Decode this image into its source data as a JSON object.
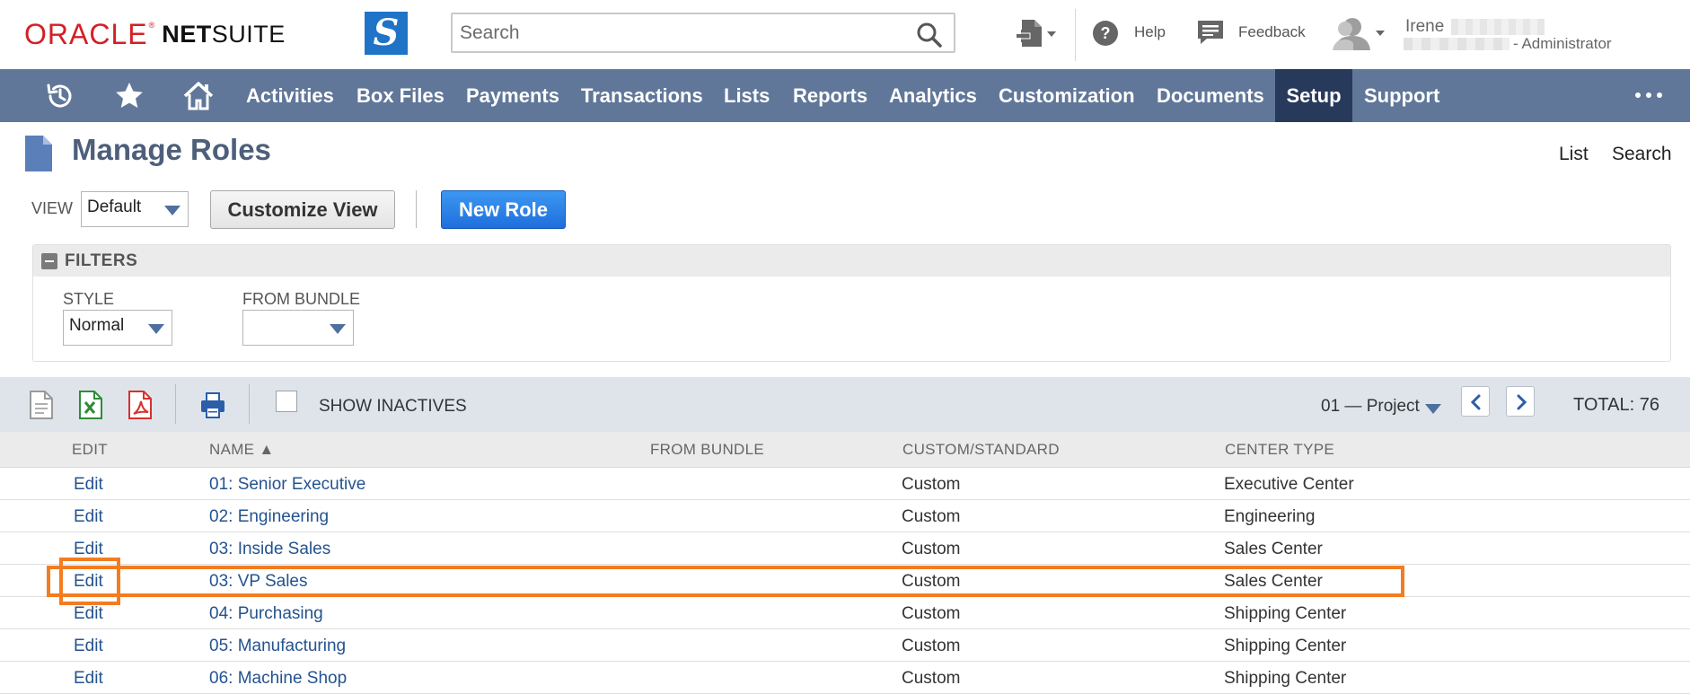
{
  "header": {
    "logo_oracle": "ORACLE",
    "logo_registered": "®",
    "logo_net": "NET",
    "logo_suite": "SUITE",
    "brand_letter": "S",
    "search_placeholder": "Search",
    "help_label": "Help",
    "feedback_label": "Feedback",
    "user_first_name": "Irene",
    "user_role": "- Administrator"
  },
  "nav": {
    "items": [
      {
        "label": "Activities"
      },
      {
        "label": "Box Files"
      },
      {
        "label": "Payments"
      },
      {
        "label": "Transactions"
      },
      {
        "label": "Lists"
      },
      {
        "label": "Reports"
      },
      {
        "label": "Analytics"
      },
      {
        "label": "Customization"
      },
      {
        "label": "Documents"
      },
      {
        "label": "Setup",
        "active": true
      },
      {
        "label": "Support"
      }
    ],
    "more": "..."
  },
  "page": {
    "title": "Manage Roles",
    "list_link": "List",
    "search_link": "Search",
    "view_label": "VIEW",
    "view_value": "Default",
    "customize_view": "Customize View",
    "new_role": "New Role"
  },
  "filters": {
    "title": "FILTERS",
    "style_label": "STYLE",
    "style_value": "Normal",
    "bundle_label": "FROM BUNDLE",
    "bundle_value": ""
  },
  "toolbar": {
    "show_inactives": "SHOW INACTIVES",
    "show_inactives_checked": false,
    "page_value": "01 — Project",
    "total": "TOTAL: 76"
  },
  "table": {
    "columns": [
      "EDIT",
      "NAME ▲",
      "FROM BUNDLE",
      "CUSTOM/STANDARD",
      "CENTER TYPE"
    ],
    "rows": [
      {
        "edit": "Edit",
        "name": "01: Senior Executive",
        "bundle": "",
        "type": "Custom",
        "center": "Executive Center"
      },
      {
        "edit": "Edit",
        "name": "02: Engineering",
        "bundle": "",
        "type": "Custom",
        "center": "Engineering"
      },
      {
        "edit": "Edit",
        "name": "03: Inside Sales",
        "bundle": "",
        "type": "Custom",
        "center": "Sales Center"
      },
      {
        "edit": "Edit",
        "name": "03: VP Sales",
        "bundle": "",
        "type": "Custom",
        "center": "Sales Center"
      },
      {
        "edit": "Edit",
        "name": "04: Purchasing",
        "bundle": "",
        "type": "Custom",
        "center": "Shipping Center"
      },
      {
        "edit": "Edit",
        "name": "05: Manufacturing",
        "bundle": "",
        "type": "Custom",
        "center": "Shipping Center"
      },
      {
        "edit": "Edit",
        "name": "06: Machine Shop",
        "bundle": "",
        "type": "Custom",
        "center": "Shipping Center"
      }
    ]
  },
  "colors": {
    "nav_bg": "#607799",
    "nav_active": "#283a5b",
    "link": "#24538f",
    "primary_button": "#1f74c7",
    "annotation": "#f47c20"
  }
}
